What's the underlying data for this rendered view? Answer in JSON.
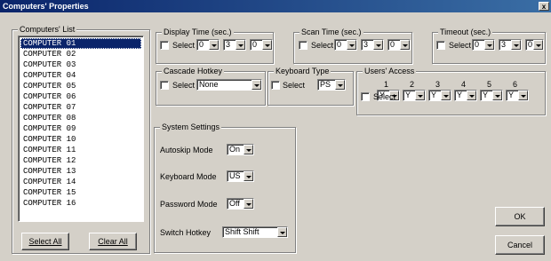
{
  "window": {
    "title": "Computers' Properties",
    "close_label": "x"
  },
  "computers_list": {
    "legend": "Computers' List",
    "items": [
      "COMPUTER 01",
      "COMPUTER 02",
      "COMPUTER 03",
      "COMPUTER 04",
      "COMPUTER 05",
      "COMPUTER 06",
      "COMPUTER 07",
      "COMPUTER 08",
      "COMPUTER 09",
      "COMPUTER 10",
      "COMPUTER 11",
      "COMPUTER 12",
      "COMPUTER 13",
      "COMPUTER 14",
      "COMPUTER 15",
      "COMPUTER 16"
    ],
    "selected_index": 0,
    "select_all_label": "Select All",
    "clear_all_label": "Clear All"
  },
  "display_time": {
    "legend": "Display Time (sec.)",
    "select_label": "Select",
    "values": [
      "0",
      "3",
      "0"
    ]
  },
  "scan_time": {
    "legend": "Scan Time (sec.)",
    "select_label": "Select",
    "values": [
      "0",
      "3",
      "0"
    ]
  },
  "timeout": {
    "legend": "Timeout (sec.)",
    "select_label": "Select",
    "values": [
      "0",
      "3",
      "0"
    ]
  },
  "cascade_hotkey": {
    "legend": "Cascade Hotkey",
    "select_label": "Select",
    "value": "None"
  },
  "keyboard_type": {
    "legend": "Keyboard Type",
    "select_label": "Select",
    "value": "PS"
  },
  "users_access": {
    "legend": "Users' Access",
    "select_label": "Select",
    "columns": [
      "1",
      "2",
      "3",
      "4",
      "5",
      "6"
    ],
    "values": [
      "Y",
      "Y",
      "Y",
      "Y",
      "Y",
      "Y"
    ]
  },
  "system_settings": {
    "legend": "System Settings",
    "autoskip_label": "Autoskip Mode",
    "autoskip_value": "On",
    "keyboard_mode_label": "Keyboard Mode",
    "keyboard_mode_value": "US",
    "password_mode_label": "Password Mode",
    "password_mode_value": "Off",
    "switch_hotkey_label": "Switch Hotkey",
    "switch_hotkey_value": "Shift Shift"
  },
  "buttons": {
    "ok_label": "OK",
    "cancel_label": "Cancel"
  }
}
